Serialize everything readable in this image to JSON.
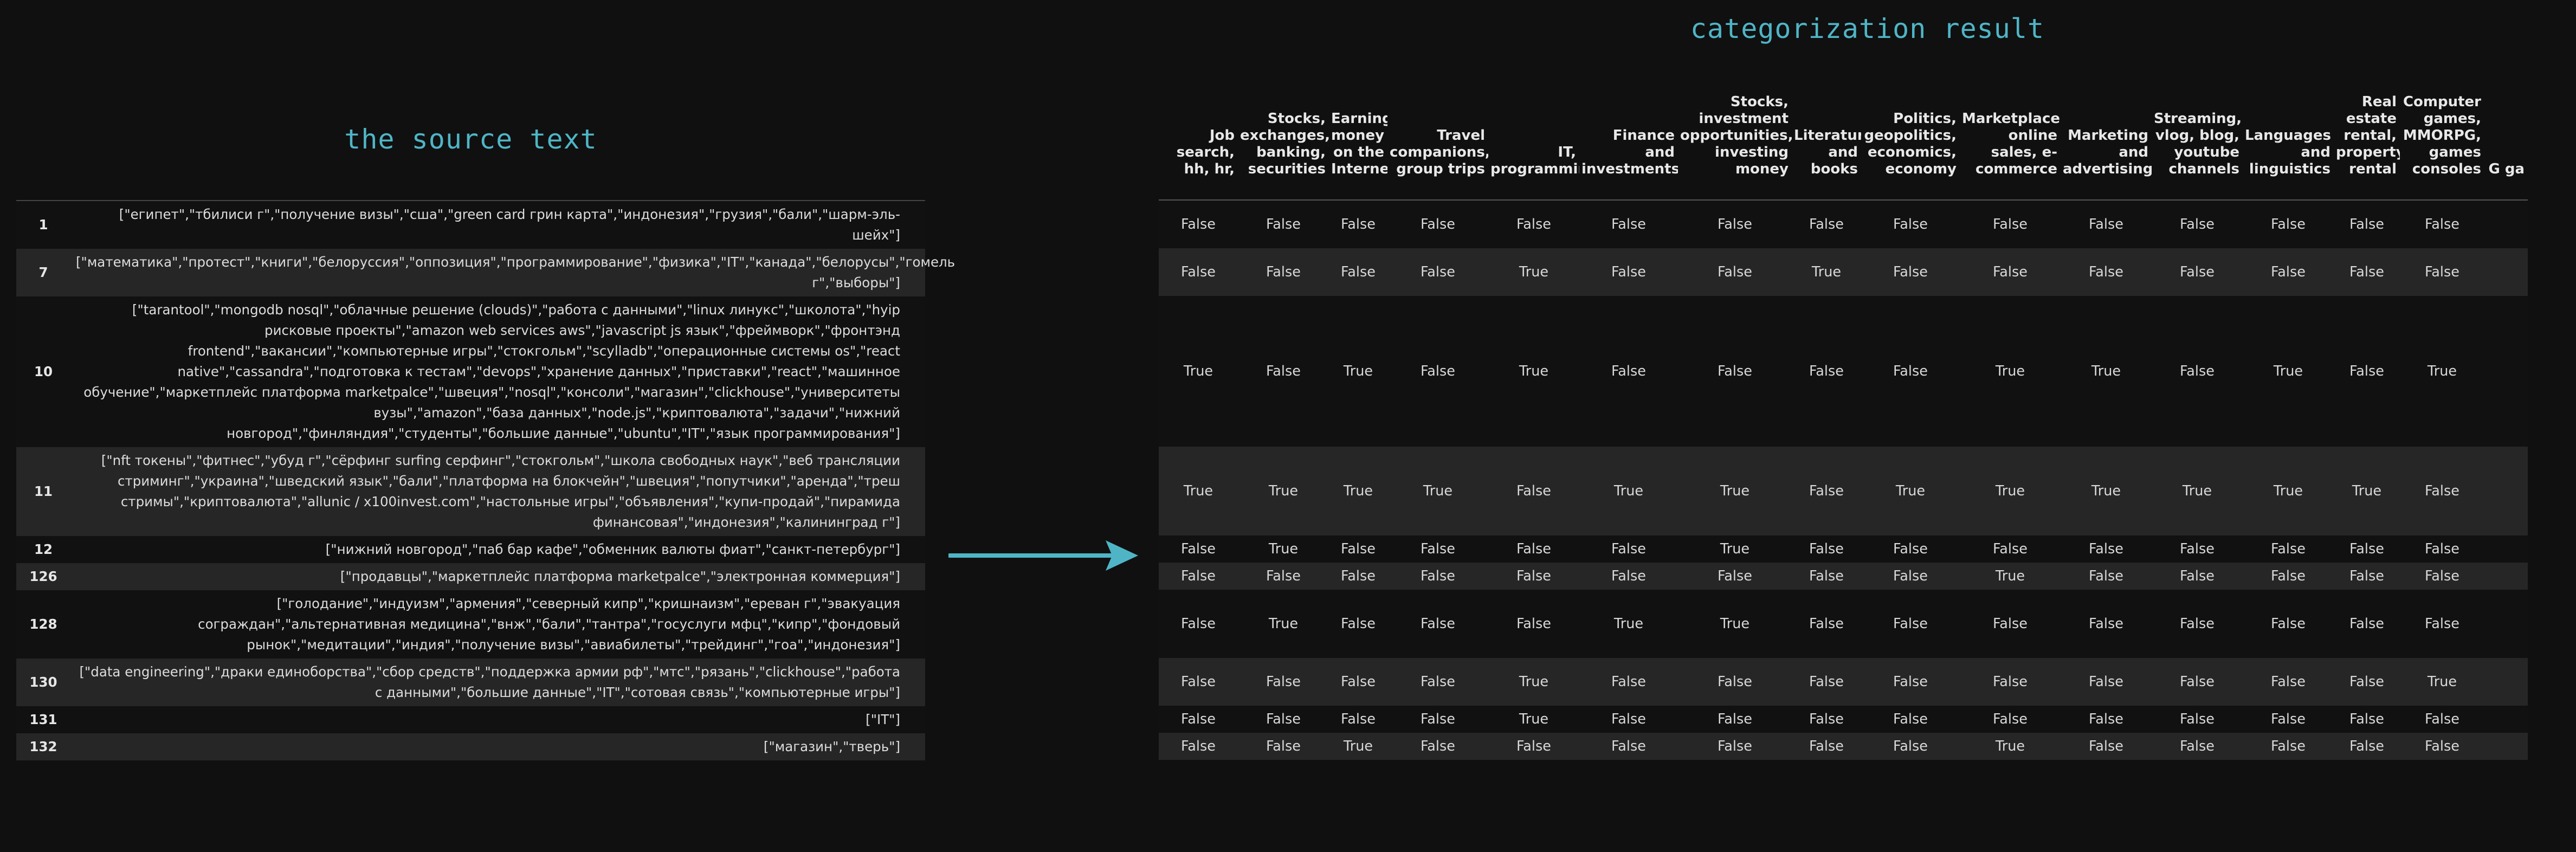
{
  "left_title": "the source text",
  "right_title": "categorization result",
  "source_rows": [
    {
      "index": "1",
      "text": "[\"египет\",\"тбилиси г\",\"получение визы\",\"сша\",\"green card грин карта\",\"индонезия\",\"грузия\",\"бали\",\"шарм-эль-шейх\"]"
    },
    {
      "index": "7",
      "text": "[\"математика\",\"протест\",\"книги\",\"белоруссия\",\"оппозиция\",\"программирование\",\"физика\",\"IT\",\"канада\",\"белорусы\",\"гомель г\",\"выборы\"]"
    },
    {
      "index": "10",
      "text": "[\"tarantool\",\"mongodb nosql\",\"облачные решение (clouds)\",\"работа с данными\",\"linux линукс\",\"школота\",\"hyip рисковые проекты\",\"amazon web services aws\",\"javascript js язык\",\"фреймворк\",\"фронтэнд frontend\",\"вакансии\",\"компьютерные игры\",\"стокгольм\",\"scylladb\",\"операционные системы os\",\"react native\",\"cassandra\",\"подготовка к тестам\",\"devops\",\"хранение данных\",\"приставки\",\"react\",\"машинное обучение\",\"маркетплейс платформа marketpalce\",\"швеция\",\"nosql\",\"консоли\",\"магазин\",\"clickhouse\",\"университеты вузы\",\"amazon\",\"база данных\",\"node.js\",\"криптовалюта\",\"задачи\",\"нижний новгород\",\"финляндия\",\"студенты\",\"большие данные\",\"ubuntu\",\"IT\",\"язык программирования\"]"
    },
    {
      "index": "11",
      "text": "[\"nft токены\",\"фитнес\",\"убуд г\",\"сёрфинг surfing серфинг\",\"стокгольм\",\"школа свободных наук\",\"веб трансляции стриминг\",\"украина\",\"шведский язык\",\"бали\",\"платформа на блокчейн\",\"швеция\",\"попутчики\",\"аренда\",\"треш стримы\",\"криптовалюта\",\"allunic / x100invest.com\",\"настольные игры\",\"объявления\",\"купи-продай\",\"пирамида финансовая\",\"индонезия\",\"калининград г\"]"
    },
    {
      "index": "12",
      "text": "[\"нижний новгород\",\"паб бар кафе\",\"обменник валюты фиат\",\"санкт-петербург\"]"
    },
    {
      "index": "126",
      "text": "[\"продавцы\",\"маркетплейс платформа marketpalce\",\"электронная коммерция\"]"
    },
    {
      "index": "128",
      "text": "[\"голодание\",\"индуизм\",\"армения\",\"северный кипр\",\"кришнаизм\",\"ереван г\",\"эвакуация сограждан\",\"альтернативная медицина\",\"внж\",\"бали\",\"тантра\",\"госуслуги мфц\",\"кипр\",\"фондовый рынок\",\"медитации\",\"индия\",\"получение визы\",\"авиабилеты\",\"трейдинг\",\"гоа\",\"индонезия\"]"
    },
    {
      "index": "130",
      "text": "[\"data engineering\",\"драки единоборства\",\"сбор средств\",\"поддержка армии рф\",\"мтс\",\"рязань\",\"clickhouse\",\"работа с данными\",\"большие данные\",\"IT\",\"сотовая связь\",\"компьютерные игры\"]"
    },
    {
      "index": "131",
      "text": "[\"IT\"]"
    },
    {
      "index": "132",
      "text": "[\"магазин\",\"тверь\"]"
    }
  ],
  "result_columns": [
    "Job search, hh, hr,",
    "Stocks, exchanges, banking, securities",
    "Earning money on the Internet",
    "Travel companions, group trips",
    "IT, programming",
    "Finance and investments",
    "Stocks, investment opportunities, investing money",
    "Literature and books",
    "Politics, geopolitics, economics, economy",
    "Marketplace, online sales, e-commerce",
    "Marketing and advertising",
    "Streaming, vlog, blog, youtube channels",
    "Languages and linguistics",
    "Real estate rental, property rental",
    "Computer games, MMORPG, games consoles",
    "G ga"
  ],
  "result_rows": [
    [
      "False",
      "False",
      "False",
      "False",
      "False",
      "False",
      "False",
      "False",
      "False",
      "False",
      "False",
      "False",
      "False",
      "False",
      "False",
      ""
    ],
    [
      "False",
      "False",
      "False",
      "False",
      "True",
      "False",
      "False",
      "True",
      "False",
      "False",
      "False",
      "False",
      "False",
      "False",
      "False",
      ""
    ],
    [
      "True",
      "False",
      "True",
      "False",
      "True",
      "False",
      "False",
      "False",
      "False",
      "True",
      "True",
      "False",
      "True",
      "False",
      "True",
      ""
    ],
    [
      "True",
      "True",
      "True",
      "True",
      "False",
      "True",
      "True",
      "False",
      "True",
      "True",
      "True",
      "True",
      "True",
      "True",
      "False",
      ""
    ],
    [
      "False",
      "True",
      "False",
      "False",
      "False",
      "False",
      "True",
      "False",
      "False",
      "False",
      "False",
      "False",
      "False",
      "False",
      "False",
      ""
    ],
    [
      "False",
      "False",
      "False",
      "False",
      "False",
      "False",
      "False",
      "False",
      "False",
      "True",
      "False",
      "False",
      "False",
      "False",
      "False",
      ""
    ],
    [
      "False",
      "True",
      "False",
      "False",
      "False",
      "True",
      "True",
      "False",
      "False",
      "False",
      "False",
      "False",
      "False",
      "False",
      "False",
      ""
    ],
    [
      "False",
      "False",
      "False",
      "False",
      "True",
      "False",
      "False",
      "False",
      "False",
      "False",
      "False",
      "False",
      "False",
      "False",
      "True",
      ""
    ],
    [
      "False",
      "False",
      "False",
      "False",
      "True",
      "False",
      "False",
      "False",
      "False",
      "False",
      "False",
      "False",
      "False",
      "False",
      "False",
      ""
    ],
    [
      "False",
      "False",
      "True",
      "False",
      "False",
      "False",
      "False",
      "False",
      "False",
      "True",
      "False",
      "False",
      "False",
      "False",
      "False",
      ""
    ]
  ],
  "colors": {
    "accent": "#4fb5c6",
    "background": "#101010",
    "row_alt": "#262626"
  },
  "arrow_icon": "right-arrow-icon"
}
